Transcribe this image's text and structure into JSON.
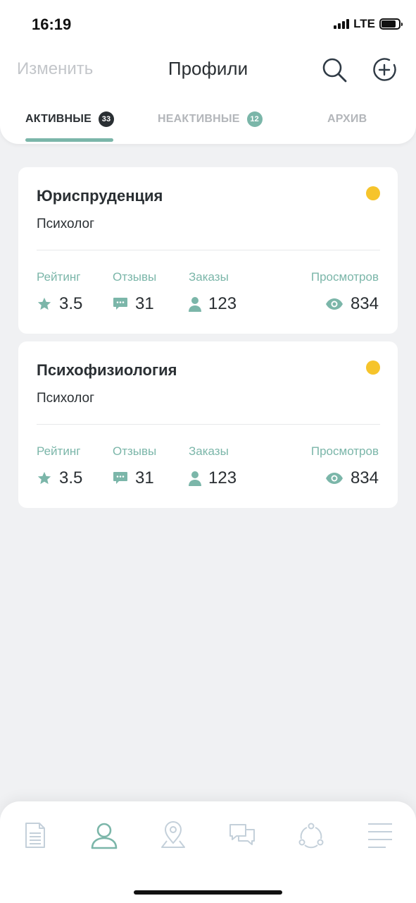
{
  "status_bar": {
    "time": "16:19",
    "network": "LTE"
  },
  "header": {
    "edit_label": "Изменить",
    "title": "Профили"
  },
  "tabs": [
    {
      "label": "АКТИВНЫЕ",
      "count": "33",
      "active": true
    },
    {
      "label": "НЕАКТИВНЫЕ",
      "count": "12",
      "active": false
    },
    {
      "label": "АРХИВ",
      "active": false
    }
  ],
  "profiles": [
    {
      "title": "Юриспруденция",
      "subtitle": "Психолог",
      "status_color": "#f6c42b",
      "stats": {
        "rating_label": "Рейтинг",
        "rating": "3.5",
        "reviews_label": "Отзывы",
        "reviews": "31",
        "orders_label": "Заказы",
        "orders": "123",
        "views_label": "Просмотров",
        "views": "834"
      }
    },
    {
      "title": "Психофизиология",
      "subtitle": "Психолог",
      "status_color": "#f6c42b",
      "stats": {
        "rating_label": "Рейтинг",
        "rating": "3.5",
        "reviews_label": "Отзывы",
        "reviews": "31",
        "orders_label": "Заказы",
        "orders": "123",
        "views_label": "Просмотров",
        "views": "834"
      }
    }
  ],
  "bottom_nav": [
    {
      "icon": "document-icon",
      "active": false
    },
    {
      "icon": "profile-icon",
      "active": true
    },
    {
      "icon": "location-icon",
      "active": false
    },
    {
      "icon": "chat-icon",
      "active": false
    },
    {
      "icon": "network-icon",
      "active": false
    },
    {
      "icon": "menu-icon",
      "active": false
    }
  ],
  "colors": {
    "accent": "#7bb6a9",
    "text": "#2a2f33",
    "muted": "#b3b6ba",
    "background": "#f0f1f3",
    "status_yellow": "#f6c42b"
  }
}
